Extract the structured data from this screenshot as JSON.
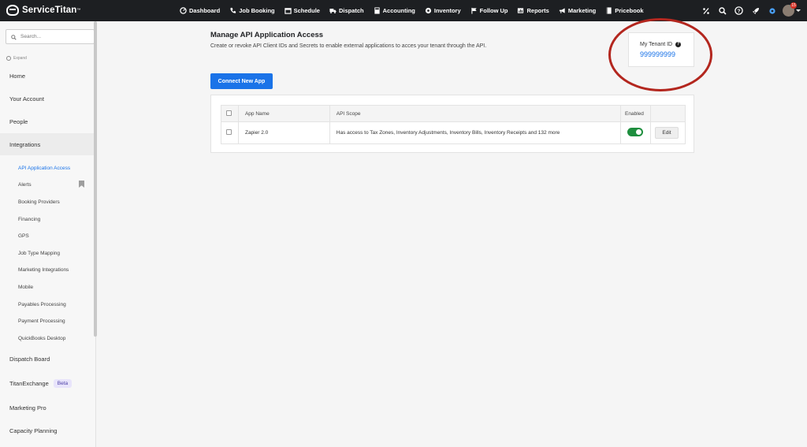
{
  "app": {
    "brand": "ServiceTitan",
    "brand_tm": "™"
  },
  "nav": [
    {
      "label": "Dashboard",
      "icon": "dashboard-icon"
    },
    {
      "label": "Job Booking",
      "icon": "phone-icon"
    },
    {
      "label": "Schedule",
      "icon": "calendar-icon"
    },
    {
      "label": "Dispatch",
      "icon": "truck-icon"
    },
    {
      "label": "Accounting",
      "icon": "calculator-icon"
    },
    {
      "label": "Inventory",
      "icon": "inventory-icon"
    },
    {
      "label": "Follow Up",
      "icon": "flag-icon"
    },
    {
      "label": "Reports",
      "icon": "reports-icon"
    },
    {
      "label": "Marketing",
      "icon": "megaphone-icon"
    },
    {
      "label": "Pricebook",
      "icon": "book-icon"
    }
  ],
  "header_icons": [
    "percent-icon",
    "search-icon",
    "help-icon",
    "rocket-icon",
    "gear-icon"
  ],
  "user": {
    "badge": "15"
  },
  "sidebar": {
    "search_placeholder": "Search...",
    "expand_label": "Expand",
    "items_top": [
      "Home",
      "Your Account",
      "People",
      "Integrations"
    ],
    "sub_items": [
      "API Application Access",
      "Alerts",
      "Booking Providers",
      "Financing",
      "GPS",
      "Job Type Mapping",
      "Marketing Integrations",
      "Mobile",
      "Payables Processing",
      "Payment Processing",
      "QuickBooks Desktop"
    ],
    "items_bottom": [
      "Dispatch Board",
      "TitanExchange",
      "Marketing Pro",
      "Capacity Planning"
    ],
    "beta_label": "Beta"
  },
  "main": {
    "title": "Manage API Application Access",
    "subtitle": "Create or revoke API Client IDs and Secrets to enable external applications to acces your tenant through the API.",
    "connect_button": "Connect New App",
    "tenant": {
      "label": "My Tenant ID",
      "value": "999999999"
    },
    "table": {
      "headers": [
        "App Name",
        "API Scope",
        "Enabled"
      ],
      "rows": [
        {
          "app_name": "Zapier 2.0",
          "scope": "Has access to Tax Zones, Inventory Adjustments, Inventory Bills, Inventory Receipts and 132 more",
          "enabled": true,
          "action": "Edit"
        }
      ]
    }
  },
  "colors": {
    "accent": "#1a73e8",
    "topbar": "#1d1f22",
    "toggle_on": "#1e8e3e",
    "annotation": "#b3261e"
  }
}
